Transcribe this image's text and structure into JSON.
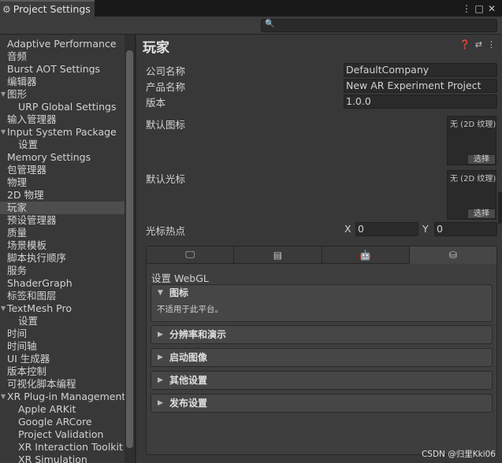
{
  "window": {
    "tab_title": "Project Settings",
    "controls": [
      "⋮",
      "□",
      "✕"
    ]
  },
  "search": {
    "placeholder": ""
  },
  "sidebar": {
    "items": [
      {
        "label": "Adaptive Performance",
        "indent": 0
      },
      {
        "label": "音频",
        "indent": 0
      },
      {
        "label": "Burst AOT Settings",
        "indent": 0
      },
      {
        "label": "编辑器",
        "indent": 0
      },
      {
        "label": "图形",
        "indent": 0,
        "expanded": true
      },
      {
        "label": "URP Global Settings",
        "indent": 1
      },
      {
        "label": "输入管理器",
        "indent": 0
      },
      {
        "label": "Input System Package",
        "indent": 0,
        "expanded": true
      },
      {
        "label": "设置",
        "indent": 1
      },
      {
        "label": "Memory Settings",
        "indent": 0
      },
      {
        "label": "包管理器",
        "indent": 0
      },
      {
        "label": "物理",
        "indent": 0
      },
      {
        "label": "2D 物理",
        "indent": 0
      },
      {
        "label": "玩家",
        "indent": 0,
        "selected": true
      },
      {
        "label": "预设管理器",
        "indent": 0
      },
      {
        "label": "质量",
        "indent": 0
      },
      {
        "label": "场景模板",
        "indent": 0
      },
      {
        "label": "脚本执行顺序",
        "indent": 0
      },
      {
        "label": "服务",
        "indent": 0
      },
      {
        "label": "ShaderGraph",
        "indent": 0
      },
      {
        "label": "标签和图层",
        "indent": 0
      },
      {
        "label": "TextMesh Pro",
        "indent": 0,
        "expanded": true
      },
      {
        "label": "设置",
        "indent": 1
      },
      {
        "label": "时间",
        "indent": 0
      },
      {
        "label": "时间轴",
        "indent": 0
      },
      {
        "label": "UI 生成器",
        "indent": 0
      },
      {
        "label": "版本控制",
        "indent": 0
      },
      {
        "label": "可视化脚本编程",
        "indent": 0
      },
      {
        "label": "XR Plug-in Management",
        "indent": 0,
        "expanded": true
      },
      {
        "label": "Apple ARKit",
        "indent": 1
      },
      {
        "label": "Google ARCore",
        "indent": 1
      },
      {
        "label": "Project Validation",
        "indent": 1
      },
      {
        "label": "XR Interaction Toolkit",
        "indent": 1
      },
      {
        "label": "XR Simulation",
        "indent": 1
      }
    ]
  },
  "main": {
    "title": "玩家",
    "header_icons": [
      "help-icon",
      "preset-icon",
      "more-icon"
    ],
    "company_label": "公司名称",
    "company_value": "DefaultCompany",
    "product_label": "产品名称",
    "product_value": "New AR Experiment Project",
    "version_label": "版本",
    "version_value": "1.0.0",
    "default_icon_label": "默认图标",
    "default_icon_none": "无 (2D 纹理)",
    "default_icon_select": "选择",
    "default_cursor_label": "默认光标",
    "default_cursor_none": "无 (2D 纹理)",
    "default_cursor_select": "选择",
    "hotspot_label": "光标热点",
    "hotspot_x_label": "X",
    "hotspot_x": "0",
    "hotspot_y_label": "Y",
    "hotspot_y": "0",
    "platform_tabs": [
      {
        "icon": "desktop-icon",
        "glyph": "🖵"
      },
      {
        "icon": "server-icon",
        "glyph": "▤"
      },
      {
        "icon": "android-icon",
        "glyph": "🤖"
      },
      {
        "icon": "webgl-icon",
        "glyph": "⛁",
        "active": true
      }
    ],
    "platform_settings_label": "设置 WebGL",
    "sections": [
      {
        "label": "图标",
        "expanded": true,
        "note": "不适用于此平台。"
      },
      {
        "label": "分辨率和演示",
        "expanded": false
      },
      {
        "label": "启动图像",
        "expanded": false
      },
      {
        "label": "其他设置",
        "expanded": false
      },
      {
        "label": "发布设置",
        "expanded": false
      }
    ]
  },
  "watermark": "CSDN @归里Kki06"
}
